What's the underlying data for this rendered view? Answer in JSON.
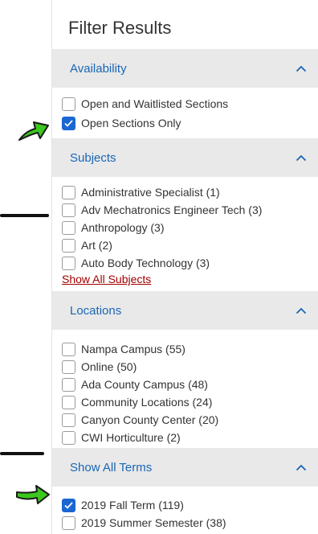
{
  "panel": {
    "title": "Filter Results"
  },
  "sections": {
    "availability": {
      "label": "Availability",
      "options": [
        {
          "label": "Open and Waitlisted Sections",
          "checked": false
        },
        {
          "label": "Open Sections Only",
          "checked": true
        }
      ]
    },
    "subjects": {
      "label": "Subjects",
      "options": [
        {
          "label": "Administrative Specialist (1)",
          "checked": false
        },
        {
          "label": "Adv Mechatronics Engineer Tech (3)",
          "checked": false
        },
        {
          "label": "Anthropology (3)",
          "checked": false
        },
        {
          "label": "Art (2)",
          "checked": false
        },
        {
          "label": "Auto Body Technology (3)",
          "checked": false
        }
      ],
      "show_all": "Show All Subjects"
    },
    "locations": {
      "label": "Locations",
      "options": [
        {
          "label": "Nampa Campus (55)",
          "checked": false
        },
        {
          "label": "Online (50)",
          "checked": false
        },
        {
          "label": "Ada County Campus (48)",
          "checked": false
        },
        {
          "label": "Community Locations (24)",
          "checked": false
        },
        {
          "label": "Canyon County Center (20)",
          "checked": false
        },
        {
          "label": "CWI Horticulture (2)",
          "checked": false
        }
      ]
    },
    "terms": {
      "label": "Show All Terms",
      "options": [
        {
          "label": "2019 Fall Term (119)",
          "checked": true
        },
        {
          "label": "2019 Summer Semester (38)",
          "checked": false
        }
      ]
    }
  },
  "icons": {
    "section_toggle": "chevron-up-icon",
    "annotation_arrow": "green-arrow-icon"
  },
  "colors": {
    "accent": "#1a66b5",
    "checkbox_checked": "#1a66d2",
    "link": "#a30000",
    "header_bg": "#e9e9e9",
    "arrow": "#3cc71e"
  }
}
